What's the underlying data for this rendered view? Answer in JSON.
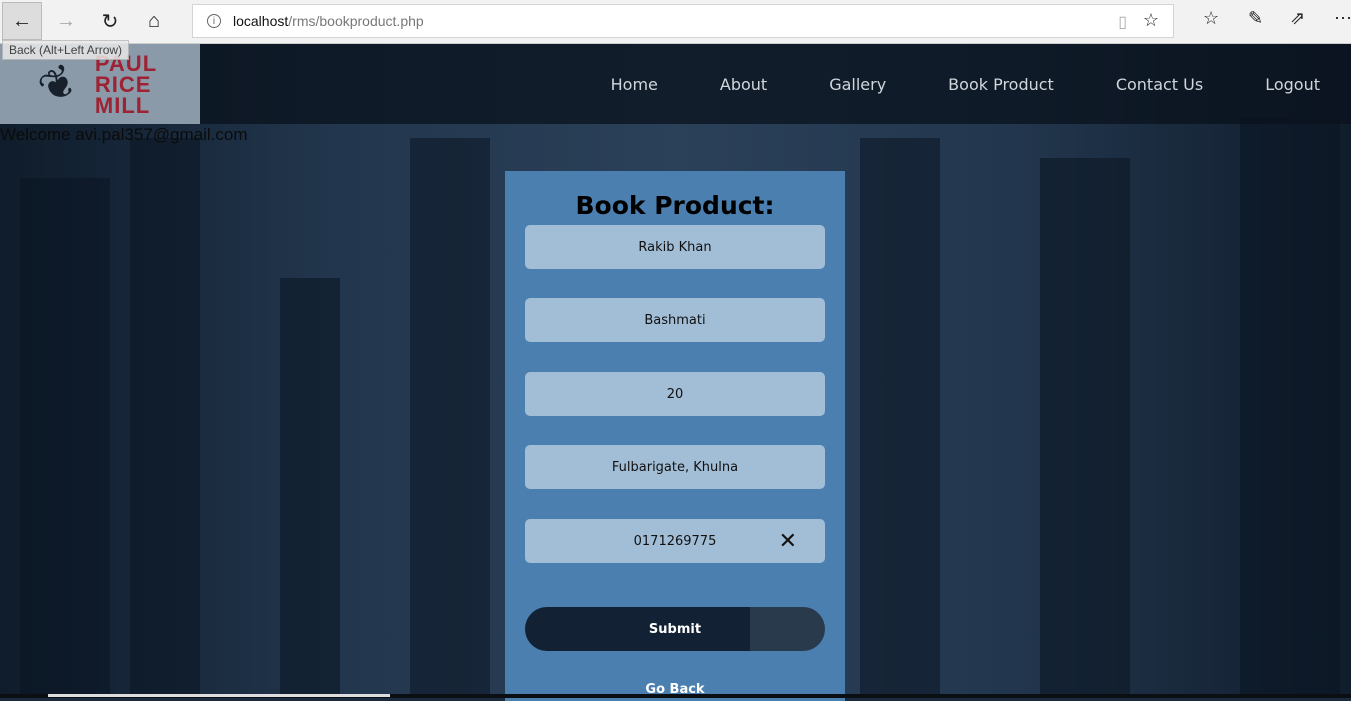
{
  "browser": {
    "back_tooltip": "Back (Alt+Left Arrow)",
    "url_host": "localhost",
    "url_path": "/rms/bookproduct.php"
  },
  "logo": {
    "text_lines": [
      "PAUL",
      "RICE",
      "MILL"
    ]
  },
  "nav": {
    "items": [
      "Home",
      "About",
      "Gallery",
      "Book Product",
      "Contact Us",
      "Logout"
    ]
  },
  "welcome": "Welcome avi.pal357@gmail.com",
  "form": {
    "title": "Book Product:",
    "fields": [
      "Rakib Khan",
      "Bashmati",
      "20",
      "Fulbarigate, Khulna",
      "0171269775"
    ],
    "submit": "Submit",
    "go_back": "Go Back"
  }
}
